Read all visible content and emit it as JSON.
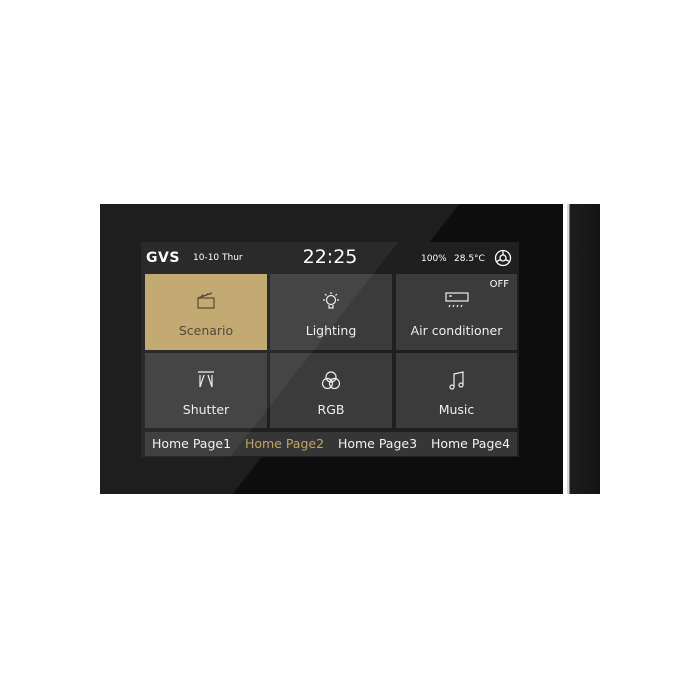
{
  "header": {
    "logo": "GVS",
    "date": "10-10 Thur",
    "time": "22:25",
    "level": "100%",
    "temperature": "28.5°C",
    "settings_icon": "gear-icon"
  },
  "tiles": [
    {
      "label": "Scenario",
      "icon": "clapperboard-icon",
      "active": true
    },
    {
      "label": "Lighting",
      "icon": "light-bulb-icon"
    },
    {
      "label": "Air conditioner",
      "icon": "air-conditioner-icon",
      "status": "OFF"
    },
    {
      "label": "Shutter",
      "icon": "curtain-icon"
    },
    {
      "label": "RGB",
      "icon": "rgb-circles-icon"
    },
    {
      "label": "Music",
      "icon": "music-note-icon"
    }
  ],
  "tabs": [
    {
      "label": "Home Page1"
    },
    {
      "label": "Home Page2",
      "active": true
    },
    {
      "label": "Home Page3"
    },
    {
      "label": "Home Page4"
    }
  ],
  "colors": {
    "accent": "#bfa56a",
    "active_tab": "#c2a464",
    "tile": "#3b3b3c",
    "bezel": "#0d0d0d"
  }
}
